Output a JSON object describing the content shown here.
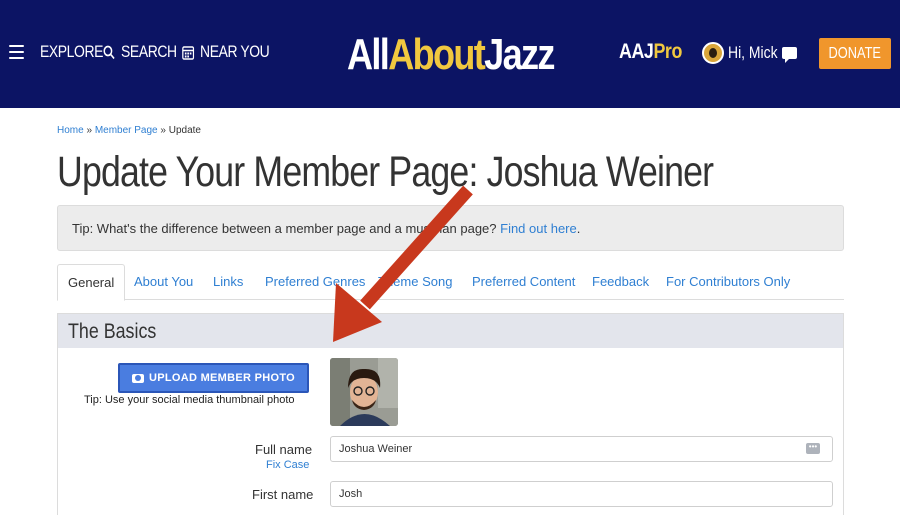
{
  "header": {
    "nav": {
      "explore": "EXPLORE",
      "search": "SEARCH",
      "near_you": "NEAR YOU"
    },
    "logo": {
      "part1": "All",
      "part2": "About",
      "part3": "Jazz"
    },
    "aajpro": {
      "part1": "AAJ",
      "part2": "Pro"
    },
    "user_greeting": "Hi, Mick",
    "donate_label": "DONATE"
  },
  "breadcrumb": {
    "home": "Home",
    "sep1": " » ",
    "member_page": "Member Page",
    "sep2": " » ",
    "current": "Update"
  },
  "page_title": "Update Your Member Page: Joshua Weiner",
  "tip": {
    "text": "Tip: What's the difference between a member page and a musician page? ",
    "link": "Find out here",
    "end": "."
  },
  "tabs": [
    {
      "label": "General"
    },
    {
      "label": "About You"
    },
    {
      "label": "Links"
    },
    {
      "label": "Preferred Genres"
    },
    {
      "label": "Theme Song"
    },
    {
      "label": "Preferred Content"
    },
    {
      "label": "Feedback"
    },
    {
      "label": "For Contributors Only"
    }
  ],
  "section": {
    "title": "The Basics",
    "upload_label": "UPLOAD MEMBER PHOTO",
    "upload_tip": "Tip: Use your social media thumbnail photo",
    "full_name_label": "Full name",
    "fix_case": "Fix Case",
    "full_name_value": "Joshua Weiner",
    "first_name_label": "First name",
    "first_name_value": "Josh"
  },
  "colors": {
    "header_bg": "#0c1464",
    "accent_yellow": "#f1c83f",
    "donate": "#f0962c",
    "link": "#2f7fd2",
    "upload_button": "#4a7de0",
    "annotation_arrow": "#c8381d"
  }
}
